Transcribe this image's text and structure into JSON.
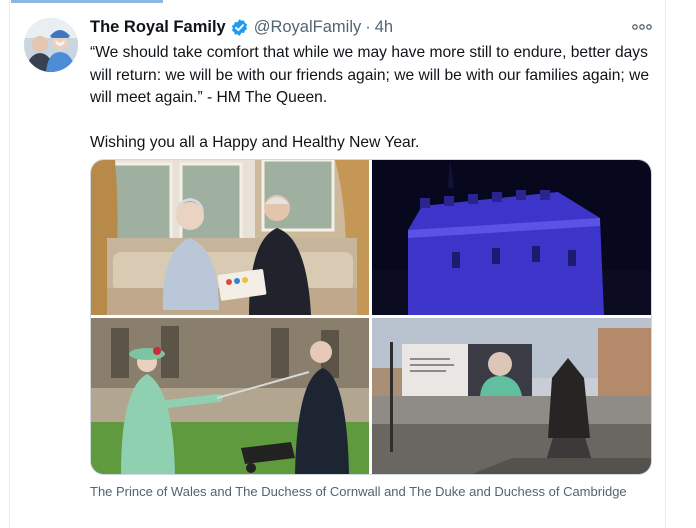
{
  "tweet": {
    "name": "The Royal Family",
    "handle": "@RoyalFamily",
    "separator": "·",
    "time": "4h",
    "quote": "“We should take comfort that while we may have more still to endure, better days will return: we will be with our friends again; we will be with our families again; we will meet again.” - HM The Queen.",
    "wish": "Wishing you all a Happy and Healthy New Year.",
    "caption": "The Prince of Wales and The Duchess of Cornwall and The Duke and Duchess of Cambridge"
  },
  "icons": {
    "verified": "verified-badge-icon",
    "more": "more-options-icon"
  },
  "colors": {
    "verified": "#1d9bf0",
    "secondary_text": "#536471",
    "accent_tab": "#8bb8e0",
    "castle_lights": "#3d35c9"
  }
}
